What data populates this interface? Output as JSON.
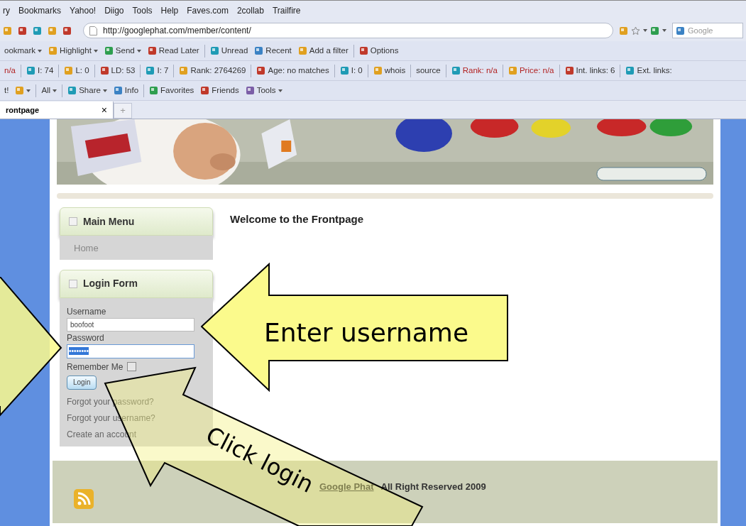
{
  "menu_bar": [
    "ry",
    "Bookmarks",
    "Yahoo!",
    "Diigo",
    "Tools",
    "Help",
    "Faves.com",
    "2collab",
    "Trailfire"
  ],
  "address_bar": {
    "url": "http://googlephat.com/member/content/",
    "search_placeholder": "Google"
  },
  "toolbars": [
    [
      {
        "kind": "label",
        "label": "ookmark",
        "dropdown": true
      },
      {
        "kind": "icon-label",
        "label": "Highlight",
        "dropdown": true
      },
      {
        "kind": "icon-label",
        "label": "Send",
        "dropdown": true
      },
      {
        "kind": "icon-label",
        "label": "Read Later",
        "dropdown": false
      },
      {
        "kind": "divider"
      },
      {
        "kind": "icon-label",
        "label": "Unread",
        "dropdown": false
      },
      {
        "kind": "icon-label",
        "label": "Recent",
        "dropdown": false
      },
      {
        "kind": "icon-label",
        "label": "Add a filter",
        "dropdown": false
      },
      {
        "kind": "divider"
      },
      {
        "kind": "icon-label",
        "label": "Options",
        "dropdown": false
      }
    ],
    [
      {
        "kind": "label",
        "label": "n/a",
        "dropdown": false,
        "color": "#b22222"
      },
      {
        "kind": "divider"
      },
      {
        "kind": "icon-label",
        "label": "I: 74",
        "dropdown": false
      },
      {
        "kind": "divider"
      },
      {
        "kind": "icon-label",
        "label": "L: 0",
        "dropdown": false
      },
      {
        "kind": "divider"
      },
      {
        "kind": "icon-label",
        "label": "LD: 53",
        "dropdown": false
      },
      {
        "kind": "divider"
      },
      {
        "kind": "icon-label",
        "label": "I: 7",
        "dropdown": false
      },
      {
        "kind": "divider"
      },
      {
        "kind": "icon-label",
        "label": "Rank: 2764269",
        "dropdown": false
      },
      {
        "kind": "divider"
      },
      {
        "kind": "icon-label",
        "label": "Age: no matches",
        "dropdown": false
      },
      {
        "kind": "divider"
      },
      {
        "kind": "icon-label",
        "label": "I: 0",
        "dropdown": false
      },
      {
        "kind": "divider"
      },
      {
        "kind": "icon-label",
        "label": "whois",
        "dropdown": false
      },
      {
        "kind": "divider"
      },
      {
        "kind": "label",
        "label": "source",
        "dropdown": false
      },
      {
        "kind": "divider"
      },
      {
        "kind": "icon-label",
        "label": "Rank: n/a",
        "dropdown": false,
        "color": "#b22222"
      },
      {
        "kind": "divider"
      },
      {
        "kind": "icon-label",
        "label": "Price: n/a",
        "dropdown": false,
        "color": "#b22222"
      },
      {
        "kind": "divider"
      },
      {
        "kind": "icon-label",
        "label": "Int. links: 6",
        "dropdown": false
      },
      {
        "kind": "divider"
      },
      {
        "kind": "icon-label",
        "label": "Ext. links:",
        "dropdown": false
      }
    ],
    [
      {
        "kind": "label",
        "label": "t!",
        "dropdown": false
      },
      {
        "kind": "icon",
        "dropdown": true
      },
      {
        "kind": "divider"
      },
      {
        "kind": "label",
        "label": "All",
        "dropdown": true
      },
      {
        "kind": "divider"
      },
      {
        "kind": "icon-label",
        "label": "Share",
        "dropdown": true
      },
      {
        "kind": "icon-label",
        "label": "Info",
        "dropdown": false
      },
      {
        "kind": "divider"
      },
      {
        "kind": "icon-label",
        "label": "Favorites",
        "dropdown": false
      },
      {
        "kind": "icon-label",
        "label": "Friends",
        "dropdown": false
      },
      {
        "kind": "icon-label",
        "label": "Tools",
        "dropdown": true
      }
    ]
  ],
  "tabs": [
    {
      "label": "rontpage",
      "close": "×",
      "selected": true
    }
  ],
  "new_tab": "+",
  "page": {
    "main_menu": {
      "title": "Main Menu",
      "items": [
        "Home"
      ]
    },
    "login_form": {
      "title": "Login Form",
      "username_label": "Username",
      "username": "boofoot",
      "password_label": "Password",
      "password": "••••••••",
      "remember_label": "Remember Me",
      "remember": false,
      "button": "Login",
      "links": [
        "Forgot your password?",
        "Forgot your username?",
        "Create an account"
      ]
    },
    "heading": "Welcome to the Frontpage",
    "footer": {
      "link": "Google Phat",
      "text": "All Right Reserved 2009"
    }
  },
  "annotations": [
    "Enter username",
    "Click login"
  ]
}
